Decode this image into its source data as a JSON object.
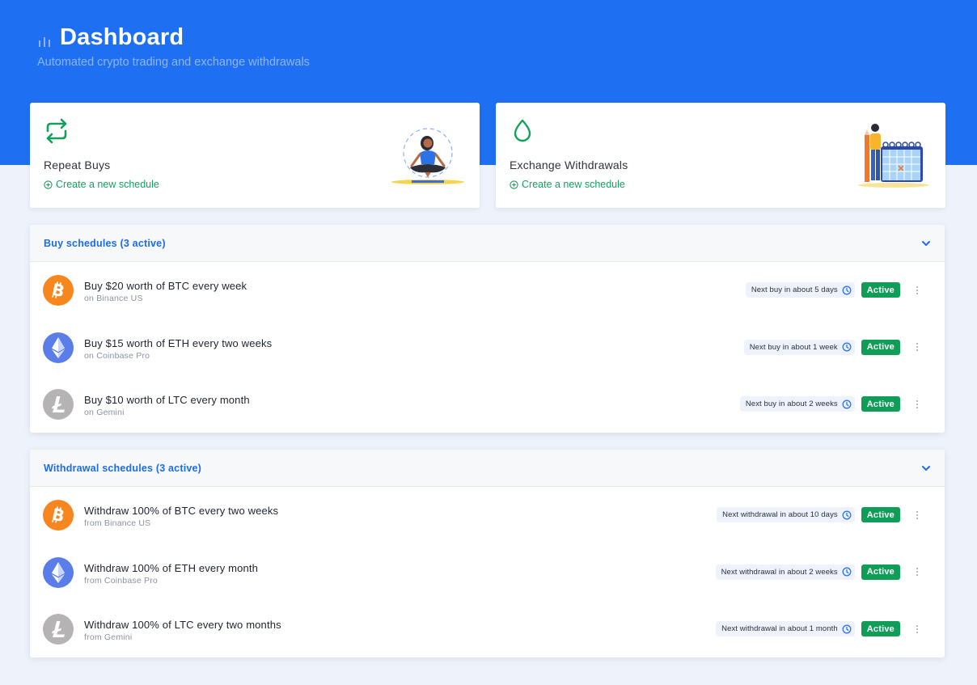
{
  "header": {
    "title": "Dashboard",
    "subtitle": "Automated crypto trading and exchange withdrawals",
    "icon": "bar-chart-icon"
  },
  "cards": [
    {
      "icon": "repeat-icon",
      "title": "Repeat Buys",
      "link_icon": "plus-circle-icon",
      "link_label": "Create a new schedule",
      "illustration": "meditation-illustration"
    },
    {
      "icon": "droplet-icon",
      "title": "Exchange Withdrawals",
      "link_icon": "plus-circle-icon",
      "link_label": "Create a new schedule",
      "illustration": "calendar-illustration"
    }
  ],
  "buy_schedules": {
    "title": "Buy schedules (3 active)",
    "toggle_icon": "chevron-down-icon",
    "rows": [
      {
        "coin": "BTC",
        "coin_icon": "bitcoin-icon",
        "title": "Buy $20 worth of BTC every week",
        "subtitle": "on Binance US",
        "next": "Next buy in about 5 days",
        "status": "Active"
      },
      {
        "coin": "ETH",
        "coin_icon": "ethereum-icon",
        "title": "Buy $15 worth of ETH every two weeks",
        "subtitle": "on Coinbase Pro",
        "next": "Next buy in about 1 week",
        "status": "Active"
      },
      {
        "coin": "LTC",
        "coin_icon": "litecoin-icon",
        "title": "Buy $10 worth of LTC every month",
        "subtitle": "on Gemini",
        "next": "Next buy in about 2 weeks",
        "status": "Active"
      }
    ]
  },
  "withdrawal_schedules": {
    "title": "Withdrawal schedules (3 active)",
    "toggle_icon": "chevron-down-icon",
    "rows": [
      {
        "coin": "BTC",
        "coin_icon": "bitcoin-icon",
        "title": "Withdraw 100% of BTC every two weeks",
        "subtitle": "from Binance US",
        "next": "Next withdrawal in about 10 days",
        "status": "Active"
      },
      {
        "coin": "ETH",
        "coin_icon": "ethereum-icon",
        "title": "Withdraw 100% of ETH every month",
        "subtitle": "from Coinbase Pro",
        "next": "Next withdrawal in about 2 weeks",
        "status": "Active"
      },
      {
        "coin": "LTC",
        "coin_icon": "litecoin-icon",
        "title": "Withdraw 100% of LTC every two months",
        "subtitle": "from Gemini",
        "next": "Next withdrawal in about 1 month",
        "status": "Active"
      }
    ]
  },
  "colors": {
    "brand_blue": "#1f6ff2",
    "accent_green": "#12a15a",
    "active_badge": "#0f9d58",
    "bitcoin": "#f7861e",
    "ethereum": "#5a7de8",
    "litecoin": "#b5b3b3"
  }
}
